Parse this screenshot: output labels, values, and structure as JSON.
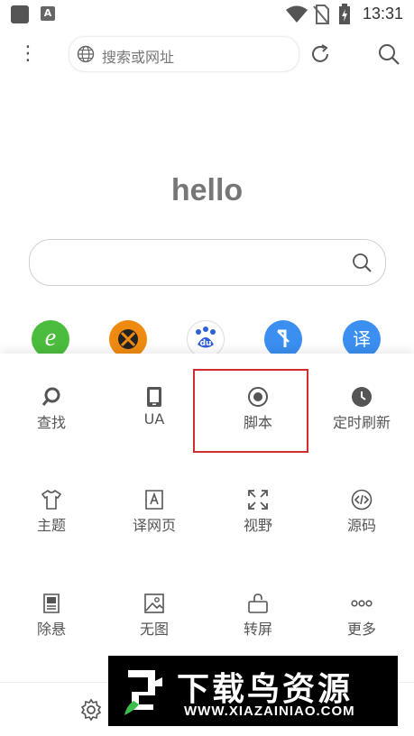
{
  "status_bar": {
    "time": "13:31",
    "notif_a": "A"
  },
  "toolbar": {
    "search_placeholder": "搜索或网址"
  },
  "home": {
    "title": "hello"
  },
  "shortcuts": {
    "translate_glyph": "译",
    "baidu_glyph": "du",
    "ie_glyph": "e"
  },
  "menu": {
    "items": [
      {
        "label": "查找",
        "icon": "search-icon"
      },
      {
        "label": "UA",
        "icon": "tablet-icon"
      },
      {
        "label": "脚本",
        "icon": "radio-dot-icon",
        "highlighted": true
      },
      {
        "label": "定时刷新",
        "icon": "clock-icon"
      },
      {
        "label": "主题",
        "icon": "shirt-icon"
      },
      {
        "label": "译网页",
        "icon": "translate-icon"
      },
      {
        "label": "视野",
        "icon": "expand-icon"
      },
      {
        "label": "源码",
        "icon": "code-icon"
      },
      {
        "label": "除悬",
        "icon": "ad-block-icon"
      },
      {
        "label": "无图",
        "icon": "image-icon"
      },
      {
        "label": "转屏",
        "icon": "rotate-icon"
      },
      {
        "label": "更多",
        "icon": "more-icon"
      }
    ],
    "highlight_color": "#d32e2e"
  },
  "watermark": {
    "title": "下载鸟资源",
    "url": "WWW.XIAZAINIAO.COM"
  }
}
